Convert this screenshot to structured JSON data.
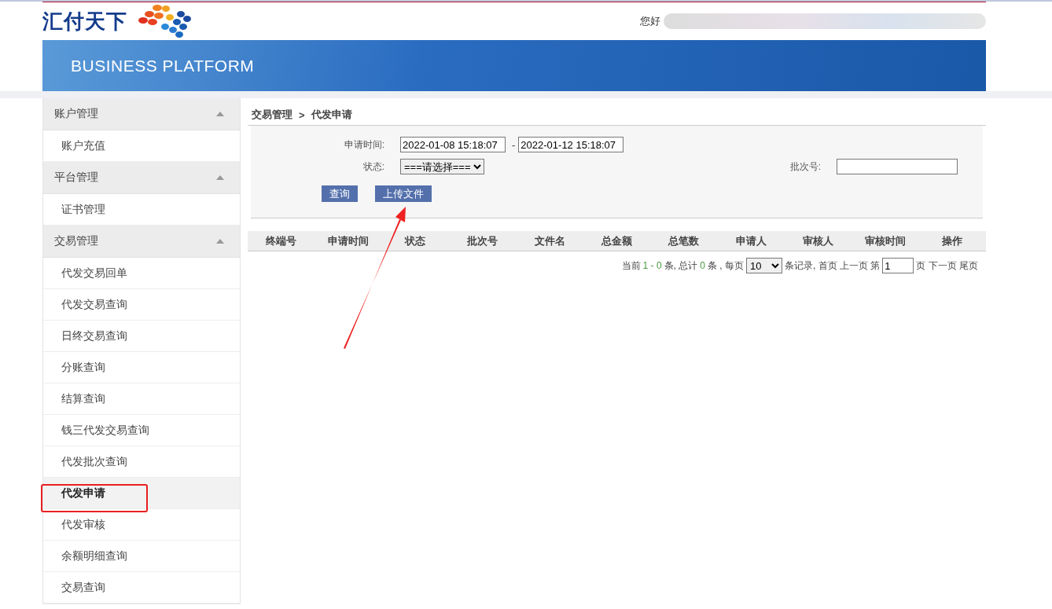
{
  "header": {
    "logo_text": "汇付天下",
    "greeting": "您好",
    "banner_title": "BUSINESS PLATFORM"
  },
  "sidebar": {
    "groups": [
      {
        "title": "账户管理",
        "expanded": true,
        "items": [
          {
            "label": "账户充值",
            "selected": false
          }
        ]
      },
      {
        "title": "平台管理",
        "expanded": true,
        "items": [
          {
            "label": "证书管理",
            "selected": false
          }
        ]
      },
      {
        "title": "交易管理",
        "expanded": true,
        "items": [
          {
            "label": "代发交易回单",
            "selected": false
          },
          {
            "label": "代发交易查询",
            "selected": false
          },
          {
            "label": "日终交易查询",
            "selected": false
          },
          {
            "label": "分账查询",
            "selected": false
          },
          {
            "label": "结算查询",
            "selected": false
          },
          {
            "label": "钱三代发交易查询",
            "selected": false
          },
          {
            "label": "代发批次查询",
            "selected": false
          },
          {
            "label": "代发申请",
            "selected": true
          },
          {
            "label": "代发审核",
            "selected": false
          },
          {
            "label": "余额明细查询",
            "selected": false
          },
          {
            "label": "交易查询",
            "selected": false
          }
        ]
      }
    ]
  },
  "breadcrumb": {
    "parent": "交易管理",
    "separator": ">",
    "current": "代发申请"
  },
  "filters": {
    "time_label": "申请时间:",
    "time_from": "2022-01-08 15:18:07",
    "time_dash": "-",
    "time_to": "2022-01-12 15:18:07",
    "status_label": "状态:",
    "status_value": "===请选择===",
    "batch_label": "批次号:"
  },
  "buttons": [
    "查询",
    "上传文件"
  ],
  "table": {
    "columns": [
      "终端号",
      "申请时间",
      "状态",
      "批次号",
      "文件名",
      "总金额",
      "总笔数",
      "申请人",
      "审核人",
      "审核时间",
      "操作"
    ]
  },
  "pagination": {
    "t1": "当前",
    "range": "1 - 0",
    "t2": "条, 总计",
    "total": "0",
    "t3": "条 , 每页",
    "page_size": "10",
    "t4": "条记录, 首页 上一页 第",
    "page": "1",
    "t5": "页 下一页 尾页"
  }
}
